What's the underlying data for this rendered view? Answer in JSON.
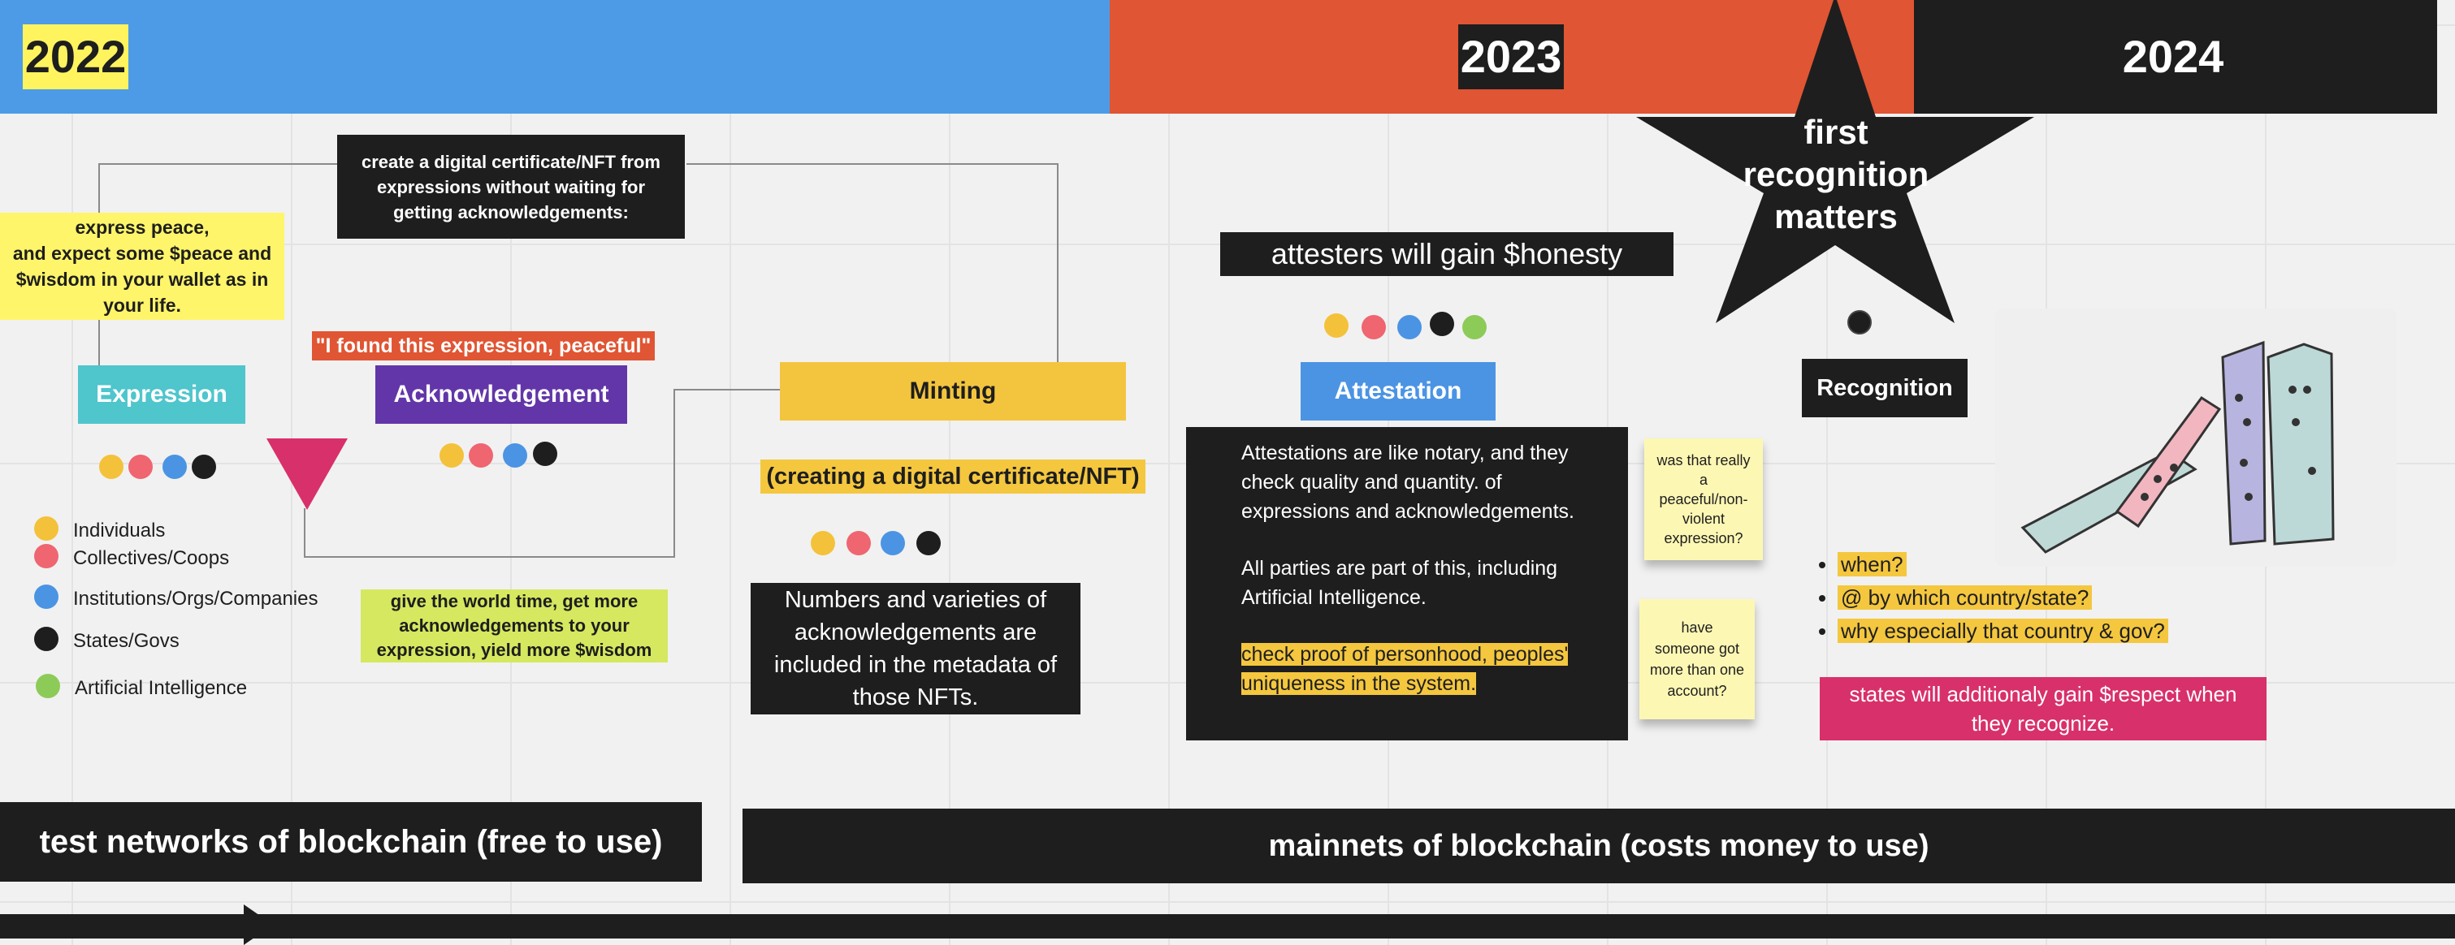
{
  "timeline": {
    "year_2022": "2022",
    "year_2023": "2023",
    "year_2024": "2024",
    "colors": {
      "y2022": "#4d9be6",
      "y2023": "#e05533",
      "y2024": "#1e1e1e"
    }
  },
  "star": {
    "text": "first recognition matters",
    "color": "#1e1e1e"
  },
  "notes": {
    "express_peace": "express peace,\nand expect some $peace and $wisdom in your wallet as in your life.",
    "create_certificate": "create a digital certificate/NFT from expressions  without waiting for getting acknowledgements:",
    "found_expression": "\"I found this expression, peaceful\"",
    "give_time": "give the world time, get more acknowledgements to your expression, yield more $wisdom",
    "creating_nft": "(creating a digital certificate/NFT)",
    "numbers_varieties": "Numbers and varieties of acknowledgements are included in the metadata of those NFTs.",
    "attesters_gain": "attesters will gain $honesty",
    "attestation_p1": "Attestations are like notary, and they check quality and quantity. of expressions and acknowledgements.",
    "attestation_p2": "All parties are part of this, including Artificial Intelligence.",
    "attestation_p3": "check proof of personhood,  peoples' uniqueness in the system.",
    "sticky_peaceful": "was that really a peaceful/non-violent expression?",
    "sticky_account": "have someone got more than one account?",
    "states_respect": "states will additionaly gain $respect when they recognize."
  },
  "stages": {
    "expression": "Expression",
    "acknowledgement": "Acknowledgement",
    "minting": "Minting",
    "attestation": "Attestation",
    "recognition": "Recognition"
  },
  "recognition_questions": [
    "when?",
    "@ by which country/state?",
    "why especially that country & gov?"
  ],
  "legend": [
    {
      "label": "Individuals",
      "color": "#f4c13a"
    },
    {
      "label": "Collectives/Coops",
      "color": "#ef6570"
    },
    {
      "label": "Institutions/Orgs/Companies",
      "color": "#4b94e4"
    },
    {
      "label": "States/Govs",
      "color": "#1e1e1e"
    },
    {
      "label": "Artificial Intelligence",
      "color": "#8dcb58"
    }
  ],
  "networks": {
    "test": "test networks of blockchain (free to use)",
    "main": "mainnets of blockchain (costs money to use)"
  },
  "colors": {
    "expression": "#4fc5cc",
    "acknowledgement": "#6236a8",
    "minting": "#f3c53f",
    "attestation": "#4b94e4",
    "recognition": "#1e1e1e",
    "highlight_yellow": "#f4c73f",
    "sticky": "#fdf7b4",
    "pink": "#d8306a",
    "lime": "#d6e85f",
    "red_note": "#e05533"
  }
}
